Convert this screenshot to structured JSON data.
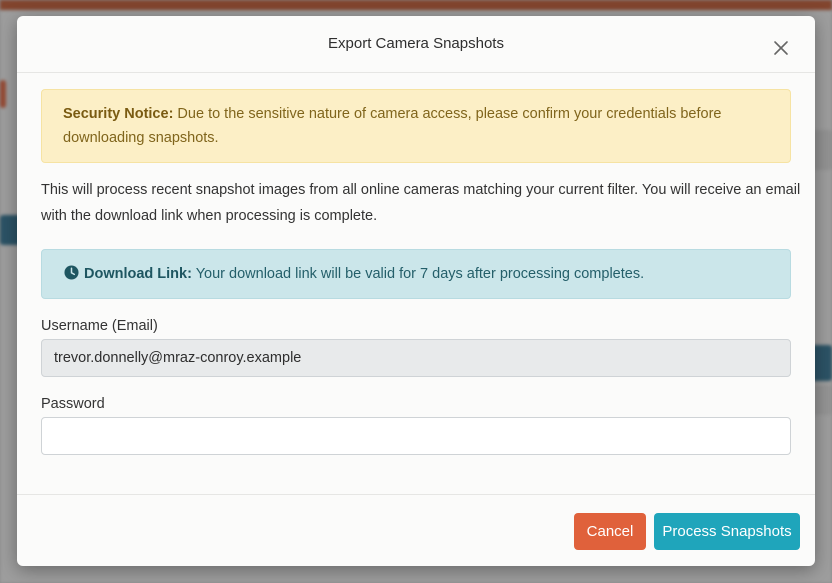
{
  "modal": {
    "title": "Export Camera Snapshots",
    "close_icon": "close-icon",
    "security_notice": {
      "label": "Security Notice:",
      "text": " Due to the sensitive nature of camera access, please confirm your credentials before downloading snapshots."
    },
    "description": "This will process recent snapshot images from all online cameras matching your current filter. You will receive an email with the download link when processing is complete.",
    "download_notice": {
      "icon": "clock-icon",
      "label": "Download Link:",
      "text": " Your download link will be valid for 7 days after processing completes."
    },
    "username": {
      "label": "Username (Email)",
      "value": "trevor.donnelly@mraz-conroy.example"
    },
    "password": {
      "label": "Password",
      "value": ""
    },
    "buttons": {
      "cancel": "Cancel",
      "process": "Process Snapshots"
    }
  },
  "colors": {
    "warning_bg": "#fcefc6",
    "info_bg": "#cbe6ea",
    "cancel": "#e0613b",
    "primary": "#1fa5bb",
    "top_bar": "#c0562f"
  }
}
